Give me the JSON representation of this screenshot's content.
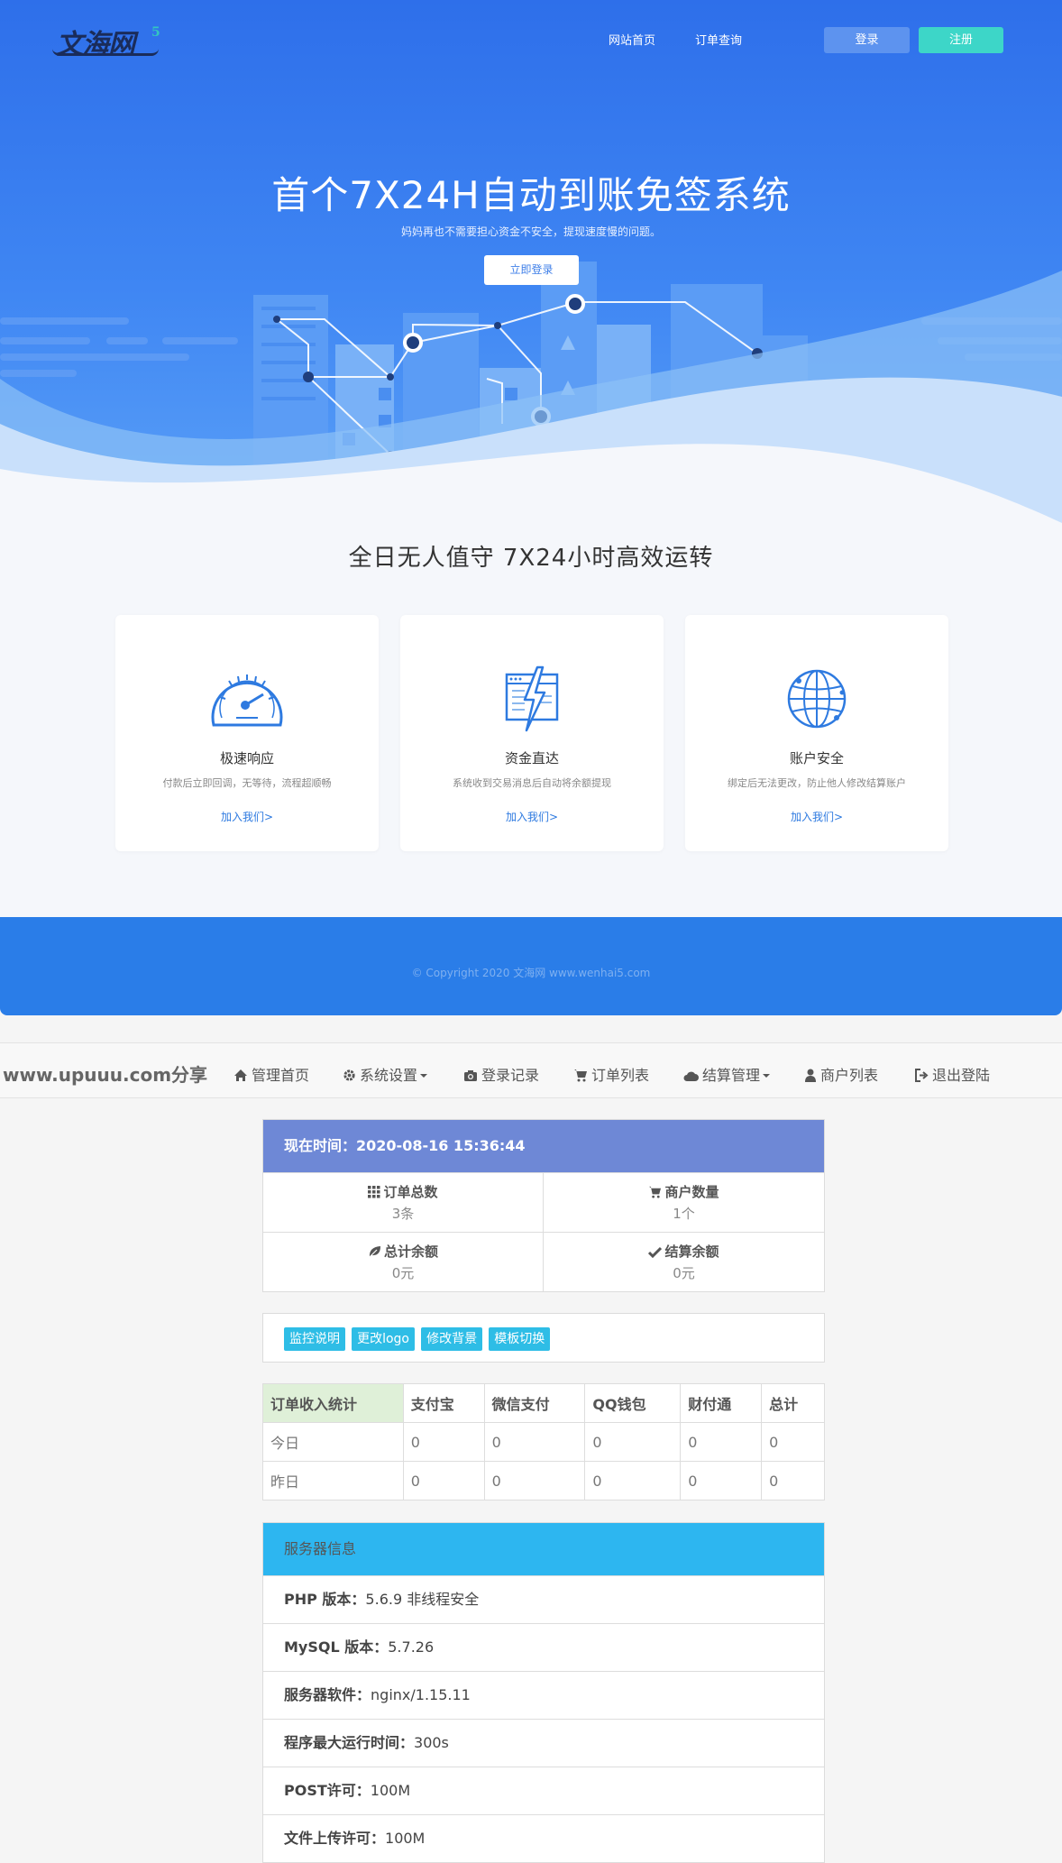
{
  "landing": {
    "logo_text": "文海网",
    "logo_mark": "5",
    "nav": [
      "网站首页",
      "订单查询"
    ],
    "login_label": "登录",
    "register_label": "注册",
    "hero_title": "首个7X24H自动到账免签系统",
    "hero_subtitle": "妈妈再也不需要担心资金不安全，提现速度慢的问题。",
    "hero_button": "立即登录",
    "section_title": "全日无人值守 7X24小时高效运转",
    "cards": [
      {
        "icon": "speedometer-icon",
        "title": "极速响应",
        "desc": "付款后立即回调，无等待，流程超顺畅",
        "link": "加入我们>"
      },
      {
        "icon": "lightning-window-icon",
        "title": "资金直达",
        "desc": "系统收到交易消息后自动将余额提现",
        "link": "加入我们>"
      },
      {
        "icon": "globe-icon",
        "title": "账户安全",
        "desc": "绑定后无法更改，防止他人修改结算账户",
        "link": "加入我们>"
      }
    ],
    "copyright": "© Copyright 2020 文海网 www.wenhai5.com",
    "colors": {
      "hero": "#3f86f3",
      "accent": "#3dd6c8",
      "footer": "#2a7de8"
    }
  },
  "admin": {
    "brand": "www.upuuu.com分享",
    "nav": [
      {
        "icon": "home-icon",
        "label": "管理首页"
      },
      {
        "icon": "gear-icon",
        "label": "系统设置",
        "dropdown": true
      },
      {
        "icon": "camera-icon",
        "label": "登录记录"
      },
      {
        "icon": "cart-icon",
        "label": "订单列表"
      },
      {
        "icon": "cloud-icon",
        "label": "结算管理",
        "dropdown": true
      },
      {
        "icon": "user-icon",
        "label": "商户列表"
      },
      {
        "icon": "logout-icon",
        "label": "退出登陆"
      }
    ],
    "time_label": "现在时间：",
    "time_value": "2020-08-16 15:36:44",
    "stats": [
      {
        "icon": "grid-icon",
        "label": "订单总数",
        "value": "3条"
      },
      {
        "icon": "cart-icon",
        "label": "商户数量",
        "value": "1个"
      },
      {
        "icon": "leaf-icon",
        "label": "总计余额",
        "value": "0元"
      },
      {
        "icon": "check-icon",
        "label": "结算余额",
        "value": "0元"
      }
    ],
    "tools": [
      "监控说明",
      "更改logo",
      "修改背景",
      "模板切换"
    ],
    "income_table": {
      "headers": [
        "订单收入统计",
        "支付宝",
        "微信支付",
        "QQ钱包",
        "财付通",
        "总计"
      ],
      "rows": [
        [
          "今日",
          "0",
          "0",
          "0",
          "0",
          "0"
        ],
        [
          "昨日",
          "0",
          "0",
          "0",
          "0",
          "0"
        ]
      ]
    },
    "server_title": "服务器信息",
    "server_info": [
      {
        "label": "PHP 版本：",
        "value": "5.6.9 非线程安全"
      },
      {
        "label": "MySQL 版本：",
        "value": "5.7.26"
      },
      {
        "label": "服务器软件：",
        "value": "nginx/1.15.11"
      },
      {
        "label": "程序最大运行时间：",
        "value": "300s"
      },
      {
        "label": "POST许可：",
        "value": "100M"
      },
      {
        "label": "文件上传许可：",
        "value": "100M"
      }
    ]
  }
}
